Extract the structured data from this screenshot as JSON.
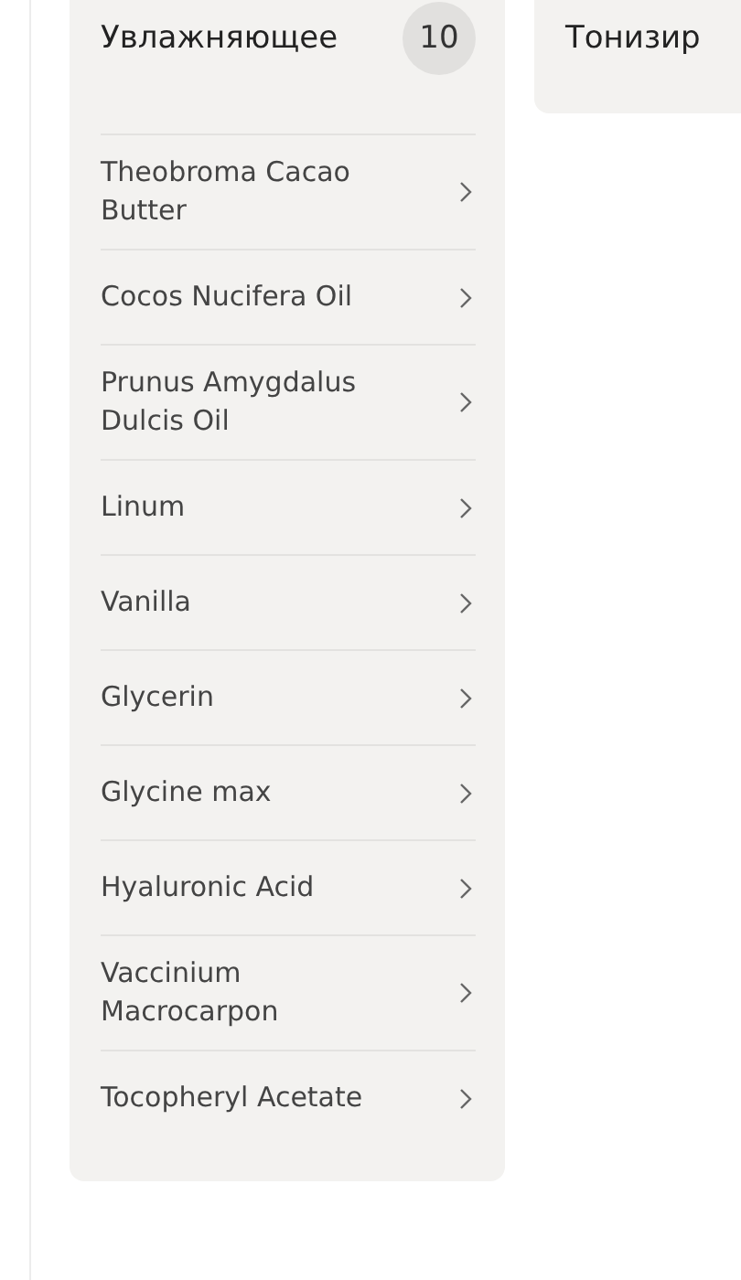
{
  "categories": [
    {
      "title": "Увлажняющее",
      "count": "10",
      "ingredients": [
        "Theobroma Cacao Butter",
        "Cocos Nucifera Oil",
        "Prunus Amygdalus Dulcis Oil",
        "Linum",
        "Vanilla",
        "Glycerin",
        "Glycine max",
        "Hyaluronic Acid",
        "Vaccinium Macrocarpon",
        "Tocopheryl Acetate"
      ]
    },
    {
      "title": "Тонизир"
    }
  ]
}
